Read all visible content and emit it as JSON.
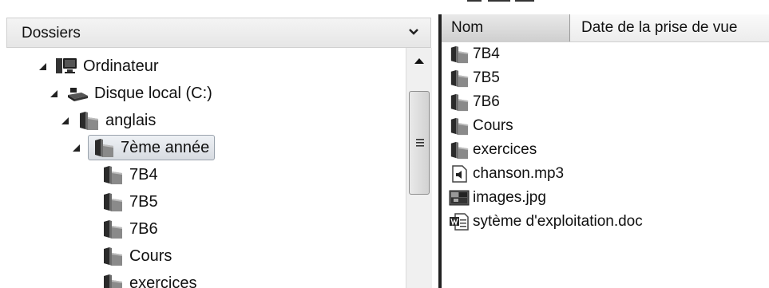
{
  "folders_pane": {
    "title": "Dossiers",
    "header_icon": "chevron-down-icon",
    "tree": [
      {
        "label": "Ordinateur",
        "icon": "computer-icon",
        "expanded": true
      },
      {
        "label": "Disque local (C:)",
        "icon": "drive-icon",
        "expanded": true
      },
      {
        "label": "anglais",
        "icon": "folder-icon",
        "expanded": true
      },
      {
        "label": "7ème année",
        "icon": "folder-icon",
        "expanded": true,
        "selected": true
      },
      {
        "label": "7B4",
        "icon": "folder-icon"
      },
      {
        "label": "7B5",
        "icon": "folder-icon"
      },
      {
        "label": "7B6",
        "icon": "folder-icon"
      },
      {
        "label": "Cours",
        "icon": "folder-icon"
      },
      {
        "label": "exercices",
        "icon": "folder-icon"
      }
    ]
  },
  "file_list": {
    "columns": [
      "Nom",
      "Date de la prise de vue"
    ],
    "items": [
      {
        "name": "7B4",
        "icon": "folder-icon"
      },
      {
        "name": "7B5",
        "icon": "folder-icon"
      },
      {
        "name": "7B6",
        "icon": "folder-icon"
      },
      {
        "name": "Cours",
        "icon": "folder-icon"
      },
      {
        "name": "exercices",
        "icon": "folder-icon"
      },
      {
        "name": "chanson.mp3",
        "icon": "audio-file-icon"
      },
      {
        "name": "images.jpg",
        "icon": "image-file-icon"
      },
      {
        "name": "sytème d'exploitation.doc",
        "icon": "word-document-icon"
      }
    ]
  },
  "colors": {
    "selection": "#d7dbe1",
    "folder": "#3a3a3a",
    "divider": "#222222"
  }
}
